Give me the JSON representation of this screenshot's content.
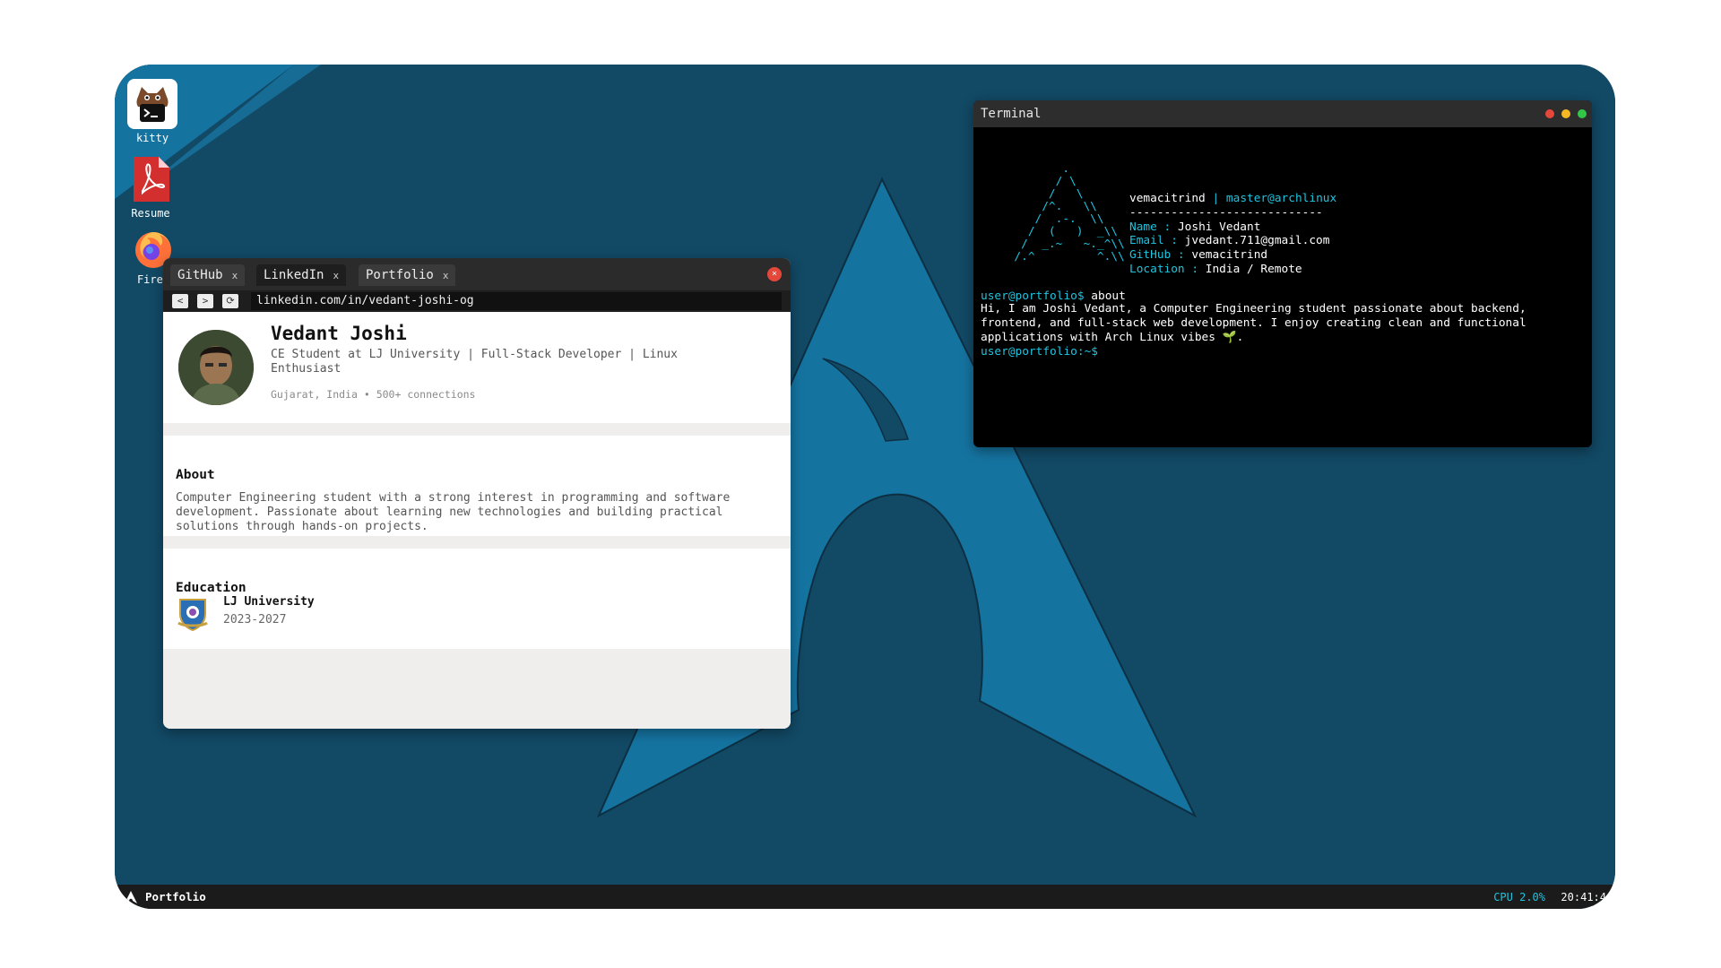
{
  "desktop": {
    "icons": [
      {
        "label": "kitty",
        "icon": "kitty-terminal-icon"
      },
      {
        "label": "Resume",
        "icon": "pdf-icon"
      },
      {
        "label": "Firef",
        "icon": "firefox-icon"
      }
    ]
  },
  "browser": {
    "tabs": [
      {
        "label": "GitHub",
        "close": "x"
      },
      {
        "label": "LinkedIn",
        "close": "x"
      },
      {
        "label": "Portfolio",
        "close": "x"
      }
    ],
    "close_label": "×",
    "nav": {
      "back": "<",
      "forward": ">",
      "reload": "⟳"
    },
    "url": "linkedin.com/in/vedant-joshi-og",
    "profile": {
      "name": "Vedant Joshi",
      "headline": "CE Student at LJ University | Full-Stack Developer | Linux Enthusiast",
      "meta": "Gujarat, India • 500+ connections"
    },
    "about": {
      "title": "About",
      "text": "Computer Engineering student with a strong interest in programming and software development. Passionate about learning new technologies and building practical solutions through hands-on projects."
    },
    "education": {
      "title": "Education",
      "school": "LJ University",
      "years": "2023-2027"
    }
  },
  "terminal": {
    "title": "Terminal",
    "ascii_art": "         .\n        / \\\n       /   \\\n      /^.   \\\\\n     /  .-.  \\\\\n    /  (   )  _\\\\\n   /  _.~   ~._^\\\\\n  /.^         ^.\\\\",
    "user": "vemacitrind",
    "separator": "|",
    "host": "master@archlinux",
    "divider": "----------------------------",
    "fields": [
      {
        "key": "Name :",
        "value": "Joshi Vedant"
      },
      {
        "key": "Email :",
        "value": "jvedant.711@gmail.com"
      },
      {
        "key": "GitHub :",
        "value": "vemacitrind"
      },
      {
        "key": "Location :",
        "value": "India / Remote"
      }
    ],
    "prompt1": "user@portfolio$",
    "command": "about",
    "output": "Hi, I am Joshi Vedant, a Computer Engineering student passionate about backend, frontend, and full-stack web development. I enjoy creating clean and functional applications with Arch Linux vibes 🌱.",
    "prompt2": "user@portfolio:~$",
    "colors": {
      "accent": "#1ec4e0",
      "close": "#e5483b",
      "minimize": "#f5b724",
      "maximize": "#33c748"
    }
  },
  "taskbar": {
    "title": "Portfolio",
    "cpu": "CPU 2.0%",
    "clock": "20:41:4"
  },
  "colors": {
    "wallpaper_dark": "#124965",
    "wallpaper_logo": "#1573a0",
    "arch_blue": "#1ec4e0"
  }
}
